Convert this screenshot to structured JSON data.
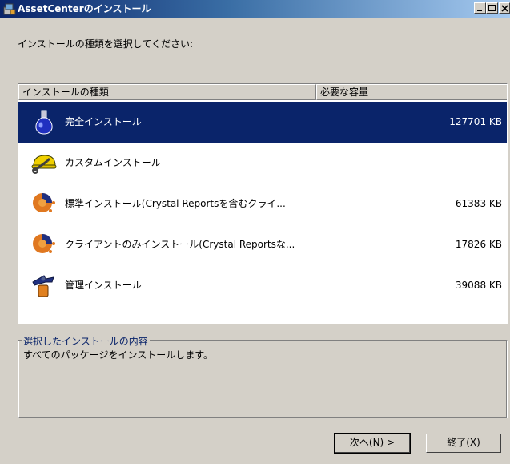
{
  "window": {
    "title": "AssetCenterのインストール"
  },
  "prompt": "インストールの種類を選択してください:",
  "list": {
    "headers": {
      "type": "インストールの種類",
      "size": "必要な容量"
    },
    "items": [
      {
        "label": "完全インストール",
        "size": "127701 KB",
        "icon": "flask-icon",
        "selected": true
      },
      {
        "label": "カスタムインストール",
        "size": "",
        "icon": "hardhat-icon",
        "selected": false
      },
      {
        "label": "標準インストール(Crystal Reportsを含むクライ...",
        "size": "61383 KB",
        "icon": "client-server-icon",
        "selected": false
      },
      {
        "label": "クライアントのみインストール(Crystal Reportsな...",
        "size": "17826 KB",
        "icon": "client-server-icon",
        "selected": false
      },
      {
        "label": "管理インストール",
        "size": "39088 KB",
        "icon": "admin-tool-icon",
        "selected": false
      }
    ]
  },
  "details": {
    "label": "選択したインストールの内容",
    "text": "すべてのパッケージをインストールします。"
  },
  "buttons": {
    "next": "次へ(N) >",
    "exit": "終了(X)"
  },
  "colors": {
    "selection": "#0a246a",
    "face": "#d4d0c8",
    "title_start": "#0a246a",
    "title_end": "#a6caf0"
  }
}
